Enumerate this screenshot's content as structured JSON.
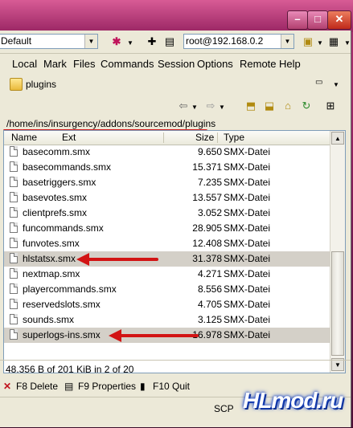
{
  "toolbar": {
    "session_combo": "Default",
    "remote_combo": "root@192.168.0.2"
  },
  "menu": [
    "Local",
    "Mark",
    "Files",
    "Commands",
    "Session",
    "Options",
    "Remote",
    "Help"
  ],
  "folder": {
    "current": "plugins"
  },
  "address": "/home/ins/insurgency/addons/sourcemod/plugins",
  "columns": {
    "name": "Name",
    "ext": "Ext",
    "size": "Size",
    "type": "Type"
  },
  "files": [
    {
      "name": "basecomm.smx",
      "size": "9.650",
      "type": "SMX-Datei"
    },
    {
      "name": "basecommands.smx",
      "size": "15.371",
      "type": "SMX-Datei"
    },
    {
      "name": "basetriggers.smx",
      "size": "7.235",
      "type": "SMX-Datei"
    },
    {
      "name": "basevotes.smx",
      "size": "13.557",
      "type": "SMX-Datei"
    },
    {
      "name": "clientprefs.smx",
      "size": "3.052",
      "type": "SMX-Datei"
    },
    {
      "name": "funcommands.smx",
      "size": "28.905",
      "type": "SMX-Datei"
    },
    {
      "name": "funvotes.smx",
      "size": "12.408",
      "type": "SMX-Datei"
    },
    {
      "name": "hlstatsx.smx",
      "size": "31.378",
      "type": "SMX-Datei"
    },
    {
      "name": "nextmap.smx",
      "size": "4.271",
      "type": "SMX-Datei"
    },
    {
      "name": "playercommands.smx",
      "size": "8.556",
      "type": "SMX-Datei"
    },
    {
      "name": "reservedslots.smx",
      "size": "4.705",
      "type": "SMX-Datei"
    },
    {
      "name": "sounds.smx",
      "size": "3.125",
      "type": "SMX-Datei"
    },
    {
      "name": "superlogs-ins.smx",
      "size": "16.978",
      "type": "SMX-Datei"
    }
  ],
  "status": {
    "summary": "48.356 B of 201 KiB in 2 of 20",
    "f8": "F8 Delete",
    "f9": "F9 Properties",
    "f10": "F10 Quit",
    "protocol": "SCP"
  },
  "watermark": "HLmod.ru",
  "colors": {
    "annotation_red": "#d21414",
    "selection": "#d4d0c8"
  }
}
